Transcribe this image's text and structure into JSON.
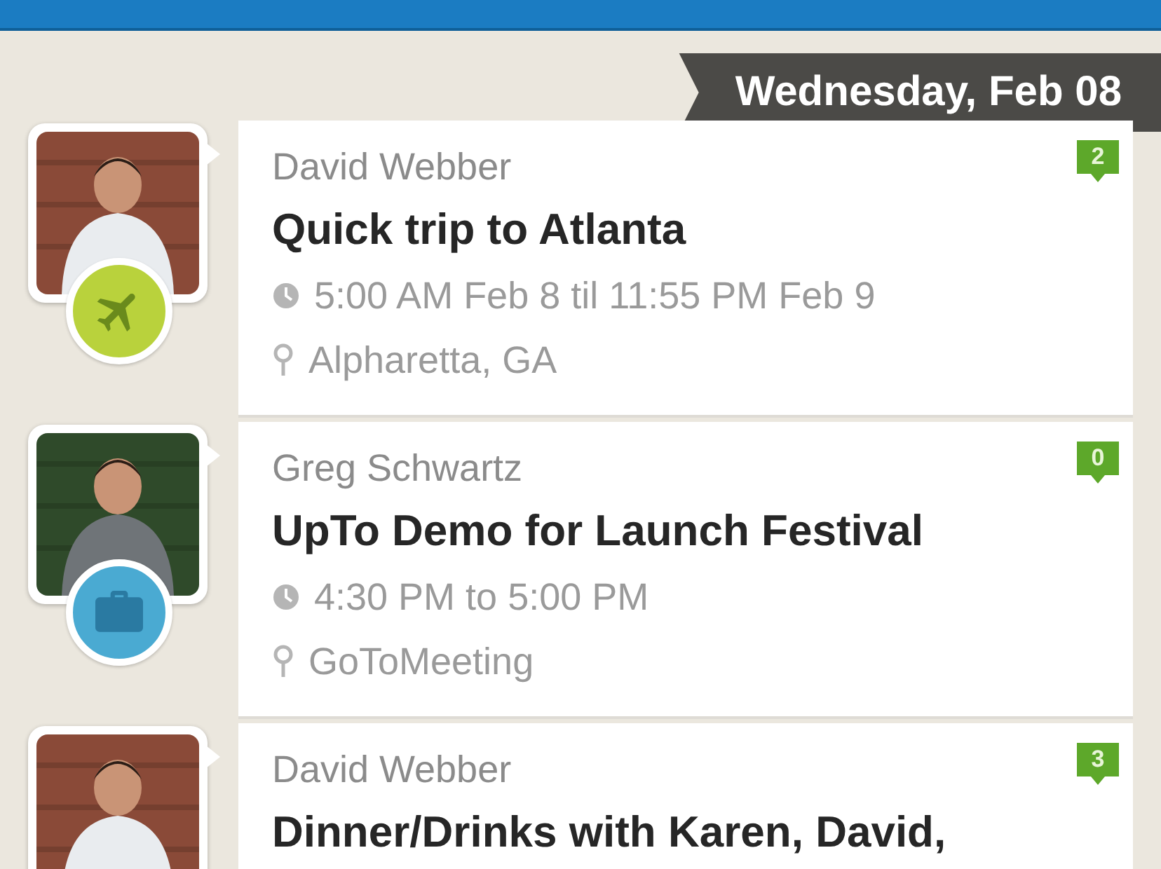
{
  "date_header": "Wednesday, Feb 08",
  "events": [
    {
      "author": "David Webber",
      "title": "Quick trip to Atlanta",
      "time": "5:00 AM Feb 8 til 11:55 PM Feb 9",
      "location": "Alpharetta, GA",
      "comments": "2",
      "kind": "travel"
    },
    {
      "author": "Greg Schwartz",
      "title": "UpTo Demo for Launch Festival",
      "time": "4:30 PM to 5:00 PM",
      "location": "GoToMeeting",
      "comments": "0",
      "kind": "work"
    },
    {
      "author": "David Webber",
      "title": "Dinner/Drinks with Karen, David,",
      "comments": "3"
    }
  ]
}
